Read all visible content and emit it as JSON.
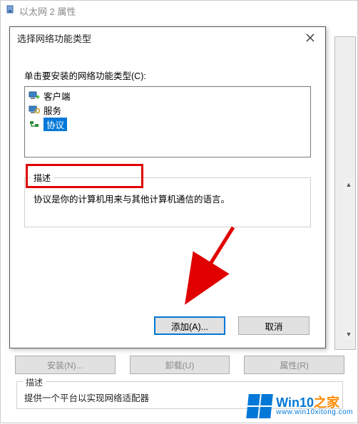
{
  "outer_window": {
    "title": "以太网 2 属性"
  },
  "dialog": {
    "title": "选择网络功能类型",
    "prompt": "单击要安装的网络功能类型(C):",
    "items": [
      {
        "label": "客户端"
      },
      {
        "label": "服务"
      },
      {
        "label": "协议"
      }
    ],
    "selected_index": 2,
    "description_legend": "描述",
    "description_text": "协议是你的计算机用来与其他计算机通信的语言。",
    "add_label": "添加(A)...",
    "cancel_label": "取消"
  },
  "background": {
    "install_label": "安装(N)...",
    "uninstall_label": "卸载(U)",
    "properties_label": "属性(R)",
    "desc_legend": "描述",
    "desc_text": "提供一个平台以实现网络适配器"
  },
  "watermark": {
    "brand": "Win10",
    "suffix": "之家",
    "url": "www.win10xitong.com"
  }
}
